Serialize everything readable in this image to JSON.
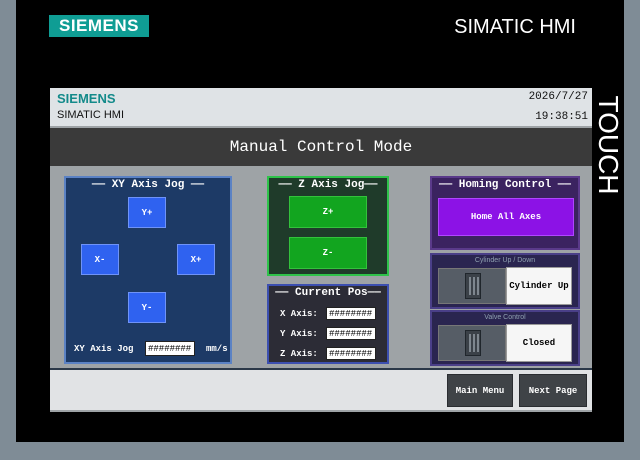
{
  "device": {
    "brand_logo": "SIEMENS",
    "model": "SIMATIC HMI",
    "side_label": "TOUCH"
  },
  "screen": {
    "header": {
      "logo": "SIEMENS",
      "model": "SIMATIC HMI",
      "date": "2026/7/27",
      "time": "19:38:51"
    },
    "title": "Manual Control Mode",
    "xy_jog": {
      "title": "—— XY Axis Jog ——",
      "y_plus": "Y+",
      "y_minus": "Y-",
      "x_plus": "X+",
      "x_minus": "X-",
      "speed_label": "XY Axis Jog",
      "speed_value": "########",
      "speed_unit": "mm/s"
    },
    "z_jog": {
      "title": "—— Z Axis Jog——",
      "z_plus": "Z+",
      "z_minus": "Z-"
    },
    "current_pos": {
      "title": "—— Current Pos——",
      "x_label": "X Axis:",
      "x_value": "########",
      "y_label": "Y Axis:",
      "y_value": "########",
      "z_label": "Z Axis:",
      "z_value": "########"
    },
    "homing": {
      "title": "—— Homing Control ——",
      "home_all": "Home All Axes"
    },
    "cylinder": {
      "title": "Cylinder Up / Down",
      "state": "Cylinder Up"
    },
    "valve": {
      "title": "Valve Control",
      "state": "Closed"
    },
    "nav": {
      "main_menu": "Main Menu",
      "next_page": "Next Page"
    }
  }
}
